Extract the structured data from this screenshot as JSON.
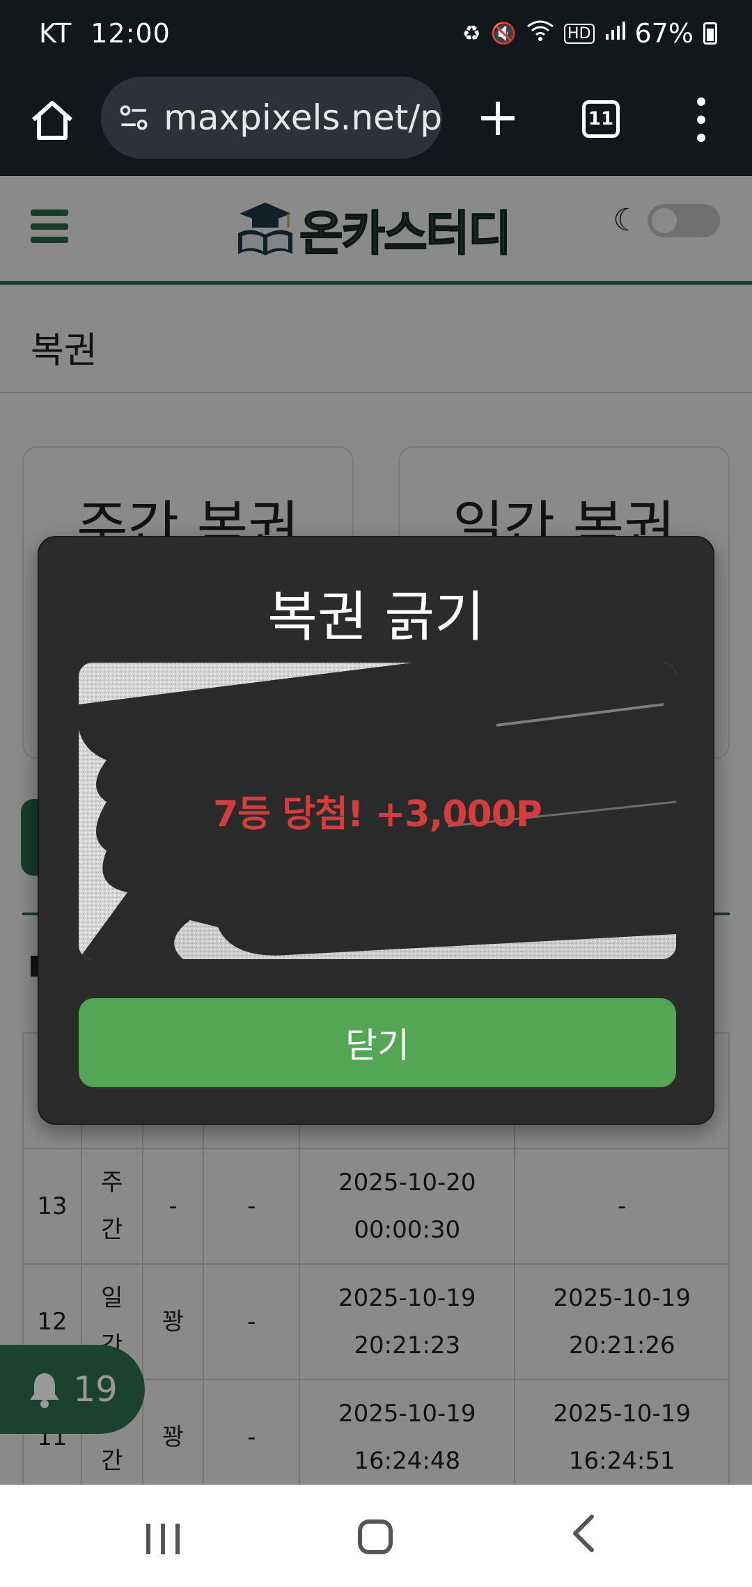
{
  "status_bar": {
    "carrier": "KT",
    "time": "12:00",
    "battery": "67%",
    "icons": [
      "battery-saver-icon",
      "mute-icon",
      "wifi-icon",
      "hd-icon",
      "signal-icon"
    ]
  },
  "browser": {
    "url": "maxpixels.net/p",
    "tab_count": "11"
  },
  "site": {
    "logo_text": "온카스터디",
    "section_title": "복권",
    "cards": [
      {
        "title": "주간 복권"
      },
      {
        "title": "일간 복권"
      }
    ]
  },
  "history": {
    "rows": [
      {
        "no": "13",
        "type": "주\n간",
        "result": "-",
        "prize": "-",
        "issued": "2025-10-20\n00:00:30",
        "scratched": "-"
      },
      {
        "no": "12",
        "type": "일\n간",
        "result": "꽝",
        "prize": "-",
        "issued": "2025-10-19\n20:21:23",
        "scratched": "2025-10-19\n20:21:26"
      },
      {
        "no": "11",
        "type": "일\n간",
        "result": "꽝",
        "prize": "-",
        "issued": "2025-10-19\n16:24:48",
        "scratched": "2025-10-19\n16:24:51"
      }
    ]
  },
  "notification": {
    "count": "19"
  },
  "modal": {
    "title": "복권 긁기",
    "prize_text": "7등 당첨! +3,000P",
    "close_label": "닫기"
  },
  "colors": {
    "brand_green": "#2d6e4f",
    "button_green": "#53a653",
    "prize_red": "#d43d3d"
  }
}
